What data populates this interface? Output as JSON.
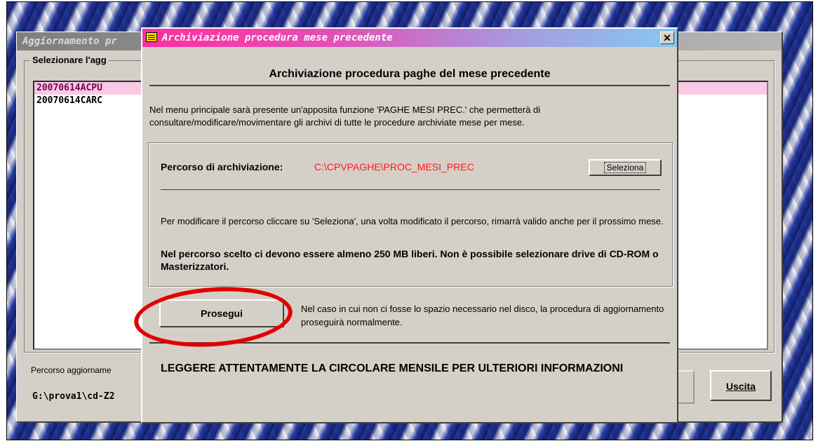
{
  "background_window": {
    "title": "Aggiornamento pr",
    "group_label": "Selezionare l'agg",
    "list_items": [
      "20070614ACPU",
      "20070614CARC"
    ],
    "path_label": "Percorso aggiorname",
    "path_value": "G:\\prova1\\cd-Z2",
    "exit_button": "Uscita"
  },
  "dialog": {
    "title": "Archiviazione procedura mese precedente",
    "close_label": "✕",
    "heading": "Archiviazione procedura paghe del mese precedente",
    "description": "Nel menu principale sarà presente un'apposita funzione 'PAGHE MESI PREC.' che permetterà di consultare/modificare/movimentare gli archivi di tutte le procedure archiviate mese per mese.",
    "path_label": "Percorso di archiviazione:",
    "path_value": "C:\\CPVPAGHE\\PROC_MESI_PREC",
    "select_button": "Seleziona",
    "change_note": "Per modificare il percorso cliccare su 'Seleziona', una volta modificato il percorso, rimarrà valido anche per il prossimo mese.",
    "space_warning": "Nel percorso scelto ci devono essere almeno 250 MB liberi. Non è possibile selezionare drive di CD-ROM o Masterizzatori.",
    "continue_button": "Prosegui",
    "continue_note": "Nel caso in cui non ci fosse lo spazio necessario nel disco, la procedura di aggiornamento proseguirà normalmente.",
    "footer_warning": "LEGGERE ATTENTAMENTE LA CIRCOLARE MENSILE PER ULTERIORI INFORMAZIONI"
  },
  "colors": {
    "title_gradient_start": "#ff2fa0",
    "title_gradient_end": "#87c9f0",
    "path_value": "#ff1a1a",
    "annotation": "#e00000",
    "selected_row": "#fbc8e6"
  }
}
